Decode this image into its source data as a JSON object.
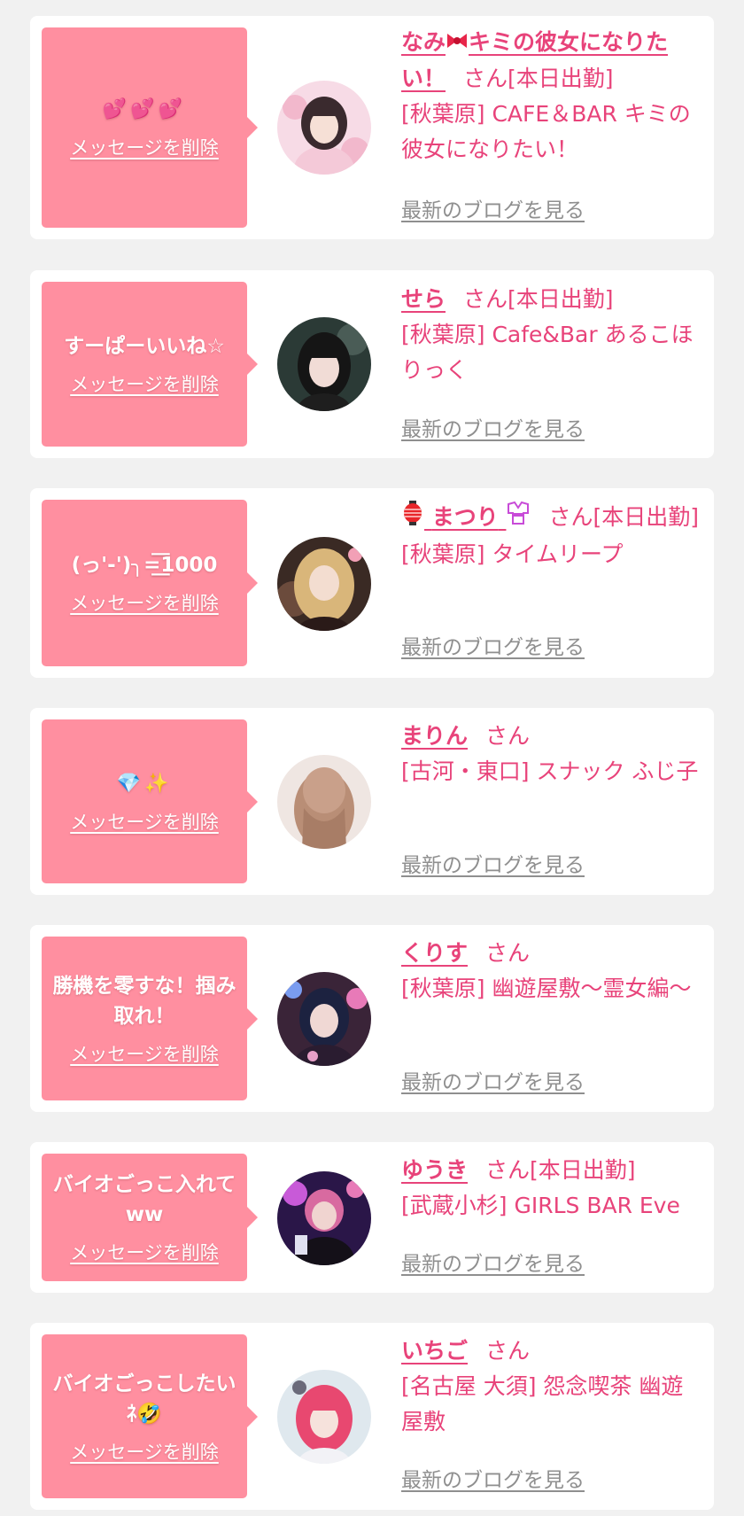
{
  "cards": [
    {
      "message": "💕💕💕",
      "delete_label": "メッセージを削除",
      "name_pre": "なみ",
      "name_icon": "ribbon-icon",
      "name_post": "キミの彼女になりたい！",
      "san": "さん[本日出勤]",
      "shop": "[秋葉原] CAFE＆BAR キミの彼女になりたい！",
      "blog_label": "最新のブログを見る"
    },
    {
      "message": "すーぱーいいね☆",
      "delete_label": "メッセージを削除",
      "name": "せら",
      "san": "さん[本日出勤]",
      "shop": "[秋葉原] Cafe&Bar あるこほりっく",
      "blog_label": "最新のブログを見る"
    },
    {
      "message": "(っ'-')╮=͟͟͞͞1000",
      "delete_label": "メッセージを削除",
      "name_icon_left": "lantern-icon",
      "name": "まつり",
      "name_icon_right": "kimono-icon",
      "san": "さん[本日出勤]",
      "shop": "[秋葉原] タイムリープ",
      "blog_label": "最新のブログを見る"
    },
    {
      "message": "💎✨",
      "delete_label": "メッセージを削除",
      "name": "まりん",
      "san": "さん",
      "shop": "[古河・東口] スナック ふじ子",
      "blog_label": "最新のブログを見る"
    },
    {
      "message": "勝機を零すな！掴み取れ！",
      "delete_label": "メッセージを削除",
      "name": "くりす",
      "san": "さん",
      "shop": "[秋葉原] 幽遊屋敷～霊女編～",
      "blog_label": "最新のブログを見る"
    },
    {
      "message": "バイオごっこ入れてww",
      "delete_label": "メッセージを削除",
      "name": "ゆうき",
      "san": "さん[本日出勤]",
      "shop": "[武蔵小杉] GIRLS BAR Eve",
      "blog_label": "最新のブログを見る"
    },
    {
      "message": "バイオごっこしたいﾈ🤣",
      "delete_label": "メッセージを削除",
      "name": "いちご",
      "san": "さん",
      "shop": "[名古屋 大須] 怨念喫茶 幽遊屋敷",
      "blog_label": "最新のブログを見る"
    }
  ],
  "colors": {
    "background": "#f1f1f1",
    "bubble": "#ff8fa0",
    "accent_pink": "#e8437a",
    "link_gray": "#8f8f8f"
  }
}
